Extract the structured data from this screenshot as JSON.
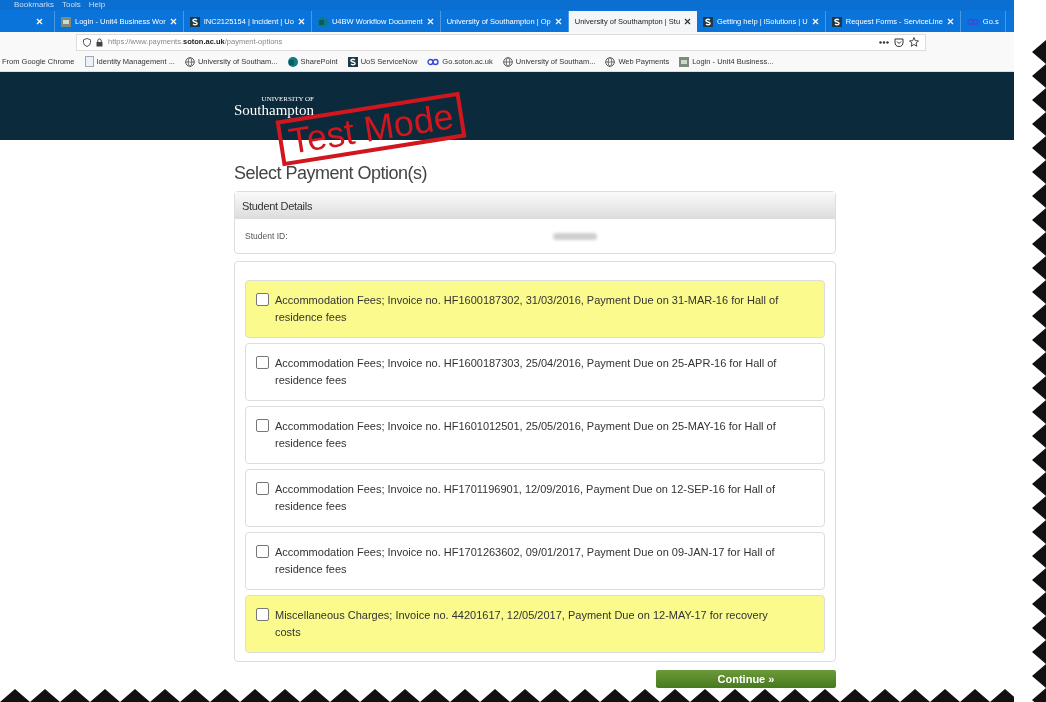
{
  "menu_bar": [
    "Bookmarks",
    "Tools",
    "Help"
  ],
  "tabs": [
    {
      "close": true,
      "selected": false
    },
    {
      "label": "Login - Unit4 Business Wor",
      "kind": "unit4",
      "close": true,
      "selected": false
    },
    {
      "label": "INC2125154 | Incident | Uo",
      "kind": "s",
      "close": true,
      "selected": false
    },
    {
      "label": "U4BW Workflow Document",
      "kind": "sharepoint",
      "close": true,
      "selected": false
    },
    {
      "label": "University of Southampton | Op",
      "close": true,
      "selected": false
    },
    {
      "label": "University of Southampton | Stu",
      "close": true,
      "selected": true
    },
    {
      "label": "Getting help | iSolutions | U",
      "kind": "s",
      "close": true,
      "selected": false
    },
    {
      "label": "Request Forms - ServiceLine",
      "kind": "s",
      "close": true,
      "selected": false
    },
    {
      "label": "Go.s",
      "kind": "go",
      "close": false,
      "selected": false
    }
  ],
  "address_bar": {
    "url": "https://www.payments.**soton.ac.uk**/payment-options"
  },
  "bookmarks": [
    {
      "label": "From Google Chrome"
    },
    {
      "label": "Identity Management ...",
      "kind": "page"
    },
    {
      "label": "University of Southam...",
      "kind": "globe"
    },
    {
      "label": "SharePoint",
      "kind": "sharepoint"
    },
    {
      "label": "UoS ServiceNow",
      "kind": "s"
    },
    {
      "label": "Go.soton.ac.uk",
      "kind": "go"
    },
    {
      "label": "University of Southam...",
      "kind": "globe"
    },
    {
      "label": "Web Payments",
      "kind": "globe"
    },
    {
      "label": "Login - Unit4 Business...",
      "kind": "unit4"
    }
  ],
  "header": {
    "logo_small": "UNIVERSITY OF",
    "logo": "Southampton",
    "stamp": "Test Mode"
  },
  "page_title": "Select Payment Option(s)",
  "student_details": {
    "title": "Student Details",
    "label": "Student ID:",
    "value_redacted": true
  },
  "options": [
    {
      "text": "Accommodation Fees; Invoice no. HF1600187302, 31/03/2016, Payment Due on 31-MAR-16 for Hall of residence fees",
      "checked": false,
      "highlighted": true
    },
    {
      "text": "Accommodation Fees; Invoice no. HF1600187303, 25/04/2016, Payment Due on 25-APR-16 for Hall of residence fees",
      "checked": false,
      "highlighted": false
    },
    {
      "text": "Accommodation Fees; Invoice no. HF1601012501, 25/05/2016, Payment Due on 25-MAY-16 for Hall of residence fees",
      "checked": false,
      "highlighted": false
    },
    {
      "text": "Accommodation Fees; Invoice no. HF1701196901, 12/09/2016, Payment Due on 12-SEP-16 for Hall of residence fees",
      "checked": false,
      "highlighted": false
    },
    {
      "text": "Accommodation Fees; Invoice no. HF1701263602, 09/01/2017, Payment Due on 09-JAN-17 for Hall of residence fees",
      "checked": false,
      "highlighted": false
    },
    {
      "text": "Miscellaneous Charges; Invoice no. 44201617, 12/05/2017, Payment Due on 12-MAY-17 for recovery costs",
      "checked": false,
      "highlighted": true
    }
  ],
  "continue_button": {
    "label": "Continue »"
  }
}
